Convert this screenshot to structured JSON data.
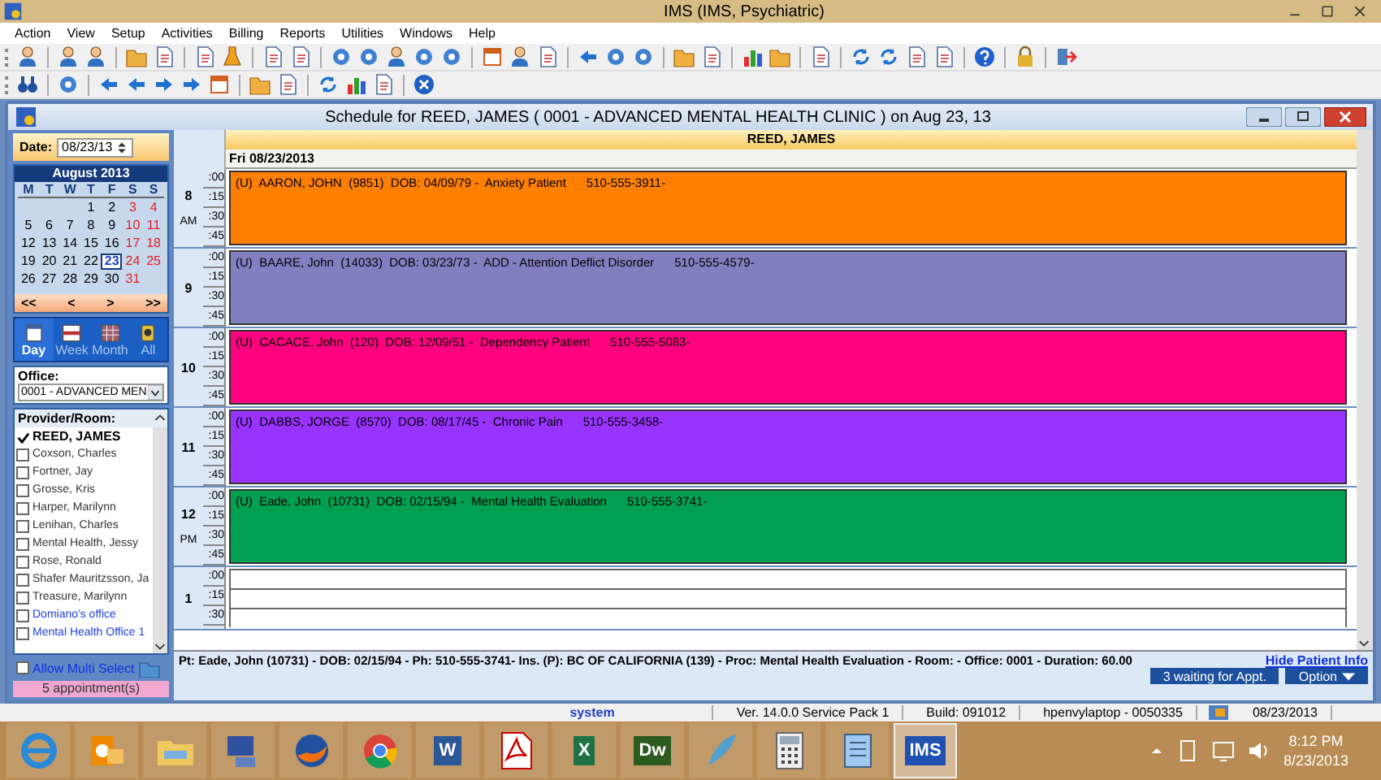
{
  "window": {
    "title": "IMS (IMS, Psychiatric)"
  },
  "menu": [
    "Action",
    "View",
    "Setup",
    "Activities",
    "Billing",
    "Reports",
    "Utilities",
    "Windows",
    "Help"
  ],
  "schedule_window": {
    "title": "Schedule for REED, JAMES ( 0001 - ADVANCED MENTAL HEALTH CLINIC  )  on  Aug 23, 13"
  },
  "date_field": {
    "label": "Date:",
    "value": "08/23/13"
  },
  "calendar": {
    "month": "August 2013",
    "weekdays": [
      "M",
      "T",
      "W",
      "T",
      "F",
      "S",
      "S"
    ],
    "weeks": [
      [
        {
          "day": "1",
          "selected": false
        },
        {
          "day": "2",
          "selected": false
        },
        {
          "day": "3",
          "selected": false
        },
        {
          "day": "4",
          "selected": false
        }
      ],
      [
        {
          "day": "5",
          "selected": false
        },
        {
          "day": "6",
          "selected": false
        },
        {
          "day": "7",
          "selected": false
        },
        {
          "day": "8",
          "selected": false
        },
        {
          "day": "9",
          "selected": false
        },
        {
          "day": "10",
          "selected": false
        },
        {
          "day": "11",
          "selected": false
        }
      ],
      [
        {
          "day": "12",
          "selected": false
        },
        {
          "day": "13",
          "selected": false
        },
        {
          "day": "14",
          "selected": false
        },
        {
          "day": "15",
          "selected": false
        },
        {
          "day": "16",
          "selected": false
        },
        {
          "day": "17",
          "selected": false
        },
        {
          "day": "18",
          "selected": false
        }
      ],
      [
        {
          "day": "19",
          "selected": false
        },
        {
          "day": "20",
          "selected": false
        },
        {
          "day": "21",
          "selected": false
        },
        {
          "day": "22",
          "selected": false
        },
        {
          "day": "23",
          "selected": true
        },
        {
          "day": "24",
          "selected": false
        },
        {
          "day": "25",
          "selected": false
        }
      ],
      [
        {
          "day": "26",
          "selected": false
        },
        {
          "day": "27",
          "selected": false
        },
        {
          "day": "28",
          "selected": false
        },
        {
          "day": "29",
          "selected": false
        },
        {
          "day": "30",
          "selected": false
        },
        {
          "day": "31",
          "selected": false
        }
      ]
    ],
    "nav": [
      "<<",
      "<",
      ">",
      ">>"
    ]
  },
  "views": [
    {
      "label": "Day",
      "selected": true
    },
    {
      "label": "Week",
      "selected": false
    },
    {
      "label": "Month",
      "selected": false
    },
    {
      "label": "All",
      "selected": false
    }
  ],
  "office": {
    "label": "Office:",
    "value": "0001 - ADVANCED MEN"
  },
  "providers": {
    "heading": "Provider/Room:",
    "items": [
      {
        "name": "REED, JAMES",
        "checked": true,
        "kind": "provider"
      },
      {
        "name": "Coxson, Charles",
        "checked": false,
        "kind": "provider"
      },
      {
        "name": "Fortner, Jay",
        "checked": false,
        "kind": "provider"
      },
      {
        "name": "Grosse, Kris",
        "checked": false,
        "kind": "provider"
      },
      {
        "name": "Harper, Marilynn",
        "checked": false,
        "kind": "provider"
      },
      {
        "name": "Lenihan, Charles",
        "checked": false,
        "kind": "provider"
      },
      {
        "name": "Mental Health, Jessy",
        "checked": false,
        "kind": "provider"
      },
      {
        "name": "Rose, Ronald",
        "checked": false,
        "kind": "provider"
      },
      {
        "name": "Shafer Mauritzsson, Ja",
        "checked": false,
        "kind": "provider"
      },
      {
        "name": "Treasure, Marilynn",
        "checked": false,
        "kind": "provider"
      },
      {
        "name": "Domiano's office",
        "checked": false,
        "kind": "room"
      },
      {
        "name": "Mental Health Office 1",
        "checked": false,
        "kind": "room"
      }
    ]
  },
  "multi_select": {
    "label": "Allow Multi Select",
    "checked": false
  },
  "appointment_count": "5 appointment(s)",
  "column_header": "REED, JAMES",
  "date_header": "Fri 08/23/2013",
  "hours": [
    {
      "hour": "8",
      "period": "AM",
      "slots": [
        ":00",
        ":15",
        ":30",
        ":45"
      ],
      "appointment": {
        "text": "(U)  AARON, JOHN  (9851)  DOB: 04/09/79 -  Anxiety Patient      510-555-3911-",
        "color": "#ff8000"
      }
    },
    {
      "hour": "9",
      "slots": [
        ":00",
        ":15",
        ":30",
        ":45"
      ],
      "appointment": {
        "text": "(U)  BAARE, John  (14033)  DOB: 03/23/73 -  ADD - Attention Deflict Disorder      510-555-4579-",
        "color": "#8080c0"
      }
    },
    {
      "hour": "10",
      "slots": [
        ":00",
        ":15",
        ":30",
        ":45"
      ],
      "appointment": {
        "text": "(U)  CACACE, John  (120)  DOB: 12/09/51 -  Dependency Patient      510-555-5083-",
        "color": "#ff0080"
      }
    },
    {
      "hour": "11",
      "slots": [
        ":00",
        ":15",
        ":30",
        ":45"
      ],
      "appointment": {
        "text": "(U)  DABBS, JORGE  (8570)  DOB: 08/17/45 -  Chronic Pain      510-555-3458-",
        "color": "#9933ff"
      }
    },
    {
      "hour": "12",
      "period": "PM",
      "slots": [
        ":00",
        ":15",
        ":30",
        ":45"
      ],
      "appointment": {
        "text": "(U)  Eade, John  (10731)  DOB: 02/15/94 -  Mental Health Evaluation      510-555-3741-",
        "color": "#00a050"
      }
    },
    {
      "hour": "1",
      "slots": [
        ":00",
        ":15",
        ":30"
      ]
    }
  ],
  "patient_info": {
    "text": "Pt: Eade, John  (10731) - DOB: 02/15/94 - Ph: 510-555-3741- Ins. (P): BC OF CALIFORNIA (139)  - Proc: Mental Health Evaluation - Room:    - Office: 0001  - Duration: 60.00",
    "link": "Hide Patient Info",
    "buttons": [
      "3 waiting for Appt.",
      "Option"
    ]
  },
  "status_bar": {
    "user": "system",
    "version": "Ver. 14.0.0 Service Pack 1",
    "build": "Build: 091012",
    "machine": "hpenvylaptop - 0050335",
    "date": "08/23/2013"
  },
  "taskbar": {
    "apps": [
      {
        "kind": "browser",
        "selected": false
      },
      {
        "kind": "mail",
        "selected": false
      },
      {
        "kind": "folder",
        "selected": false
      },
      {
        "kind": "computer",
        "selected": false
      },
      {
        "kind": "fox",
        "selected": false
      },
      {
        "kind": "wheel",
        "selected": false
      },
      {
        "kind": "letter",
        "label": "W",
        "color": "#2b5797",
        "selected": false
      },
      {
        "kind": "pdf",
        "selected": false
      },
      {
        "kind": "letter",
        "label": "X",
        "color": "#1e7145",
        "selected": false
      },
      {
        "kind": "letter",
        "label": "Dw",
        "color": "#2d5a1e",
        "selected": false
      },
      {
        "kind": "feather",
        "selected": false
      },
      {
        "kind": "calculator",
        "selected": false
      },
      {
        "kind": "notepad",
        "selected": false
      },
      {
        "kind": "letter",
        "label": "IMS",
        "color": "#2050b0",
        "selected": true
      }
    ],
    "time": "8:12 PM",
    "date": "8/23/2013"
  }
}
